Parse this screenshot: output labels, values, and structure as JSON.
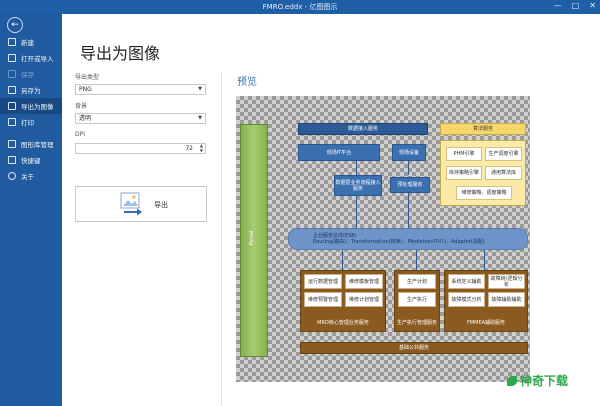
{
  "window": {
    "title": "FMRO.eddx - 亿图图示",
    "controls": [
      "—",
      "□",
      "✕"
    ]
  },
  "sidebar": {
    "back_icon": "←",
    "items": [
      {
        "label": "新建",
        "icon": "new-file-icon",
        "state": "normal"
      },
      {
        "label": "打开或导入",
        "icon": "open-folder-icon",
        "state": "normal"
      },
      {
        "label": "保存",
        "icon": "save-icon",
        "state": "disabled"
      },
      {
        "label": "另存为",
        "icon": "save-as-icon",
        "state": "normal"
      },
      {
        "label": "导出为图像",
        "icon": "export-image-icon",
        "state": "active"
      },
      {
        "label": "打印",
        "icon": "print-icon",
        "state": "normal"
      },
      {
        "label": "图形库管理",
        "icon": "library-icon",
        "state": "normal"
      },
      {
        "label": "快捷键",
        "icon": "keyboard-icon",
        "state": "normal"
      },
      {
        "label": "关于",
        "icon": "info-icon",
        "state": "normal"
      }
    ]
  },
  "main": {
    "title": "导出为图像",
    "export_type": {
      "label": "导出类型",
      "value": "PNG"
    },
    "background": {
      "label": "背景",
      "value": "透明"
    },
    "dpi": {
      "label": "DPI",
      "value": "72"
    },
    "export_button": {
      "label": "导出"
    },
    "preview_title": "预览"
  },
  "diagram": {
    "data_access": "数据接入服务",
    "algorithm": "算法服务",
    "iot": "现场IT平台",
    "device": "现场设备",
    "business_flow": "数据层业务流程接入服务",
    "pre_access": "预处理服务",
    "phm": "PHM引擎",
    "prod_engine": "生产调度引擎",
    "inventory": "库存策略引擎",
    "general": "通用算法库",
    "maintenance": "维修策略、调度策略",
    "bus_line1": "企业服务总线(ESB)",
    "bus_line2": "Routing(路由)、Transformation(转换)、Mediation(中介)、Adaptor(适配)",
    "router": "Portal",
    "ops_data": "运行数据管理",
    "repair_manage": "维修模板管理",
    "repair_forecast": "维修预警管理",
    "repair_plan": "维修计划管理",
    "prod_plan": "生产计划",
    "prod_exec": "生产执行",
    "sys_def": "系统定义辅助",
    "fault_tree": "故障树/逻辑分析",
    "fault_mode": "故障模式分析",
    "fault_aid": "故障辅助辅助",
    "mro_label": "MRO核心管理业务服务",
    "prod_label": "生产执行管理服务",
    "fmmea_label": "FMMEA辅助服务",
    "bottom": "基础公共服务"
  },
  "watermark": "神奇下载"
}
